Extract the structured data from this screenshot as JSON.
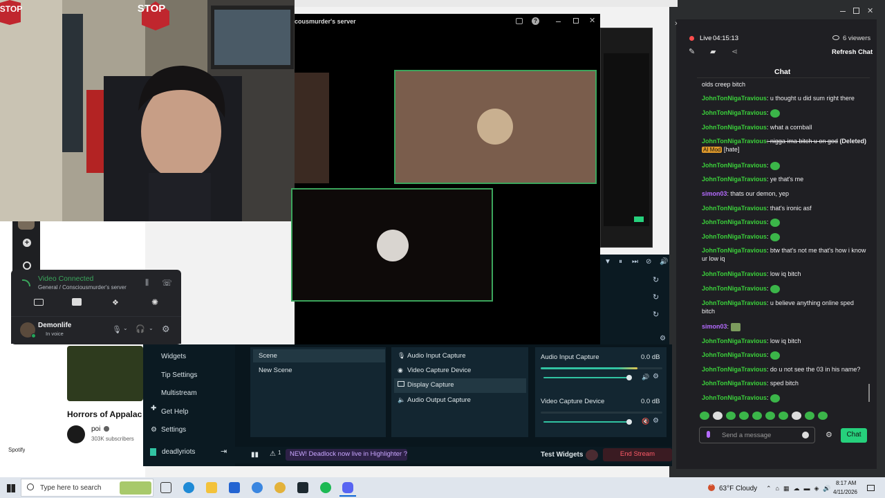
{
  "webcam": {
    "sign": "STOP",
    "sign_left": "STOP"
  },
  "discord": {
    "window_title": "cousmurder's server",
    "voice_status": "Video Connected",
    "voice_channel": "General / Consciousmurder's server",
    "user_name": "Demonlife",
    "user_status": "In voice"
  },
  "youtube": {
    "video_title": "Horrors of Appalac",
    "channel_name": "poi",
    "subscribers": "303K subscribers"
  },
  "spotify_label": "Spotify",
  "streamlabs": {
    "nav": [
      "Widgets",
      "Tip Settings",
      "Multistream",
      "Get Help",
      "Settings"
    ],
    "account": "deadlyriots",
    "scenes": [
      "Scene",
      "New Scene"
    ],
    "sources": [
      "Audio Input Capture",
      "Video Capture Device",
      "Display Capture",
      "Audio Output Capture"
    ],
    "mixer": [
      {
        "name": "Audio Input Capture",
        "db": "0.0 dB",
        "level": 0.9
      },
      {
        "name": "Video Capture Device",
        "db": "0.0 dB",
        "level": 0.0
      }
    ],
    "alert_count": "1",
    "highlighter_msg": "NEW! Deadlock now live in Highlighter ?",
    "test_widgets": "Test Widgets",
    "end_stream": "End Stream"
  },
  "chat": {
    "live_label": "Live",
    "live_time": "04:15:13",
    "viewers": "6 viewers",
    "refresh": "Refresh Chat",
    "title": "Chat",
    "messages": [
      {
        "user": "",
        "text": "olds creep bitch"
      },
      {
        "user": "JohnTonNigaTravious",
        "text": ": u thought u did sum right there"
      },
      {
        "user": "JohnTonNigaTravious",
        "text": ":"
      },
      {
        "user": "JohnTonNigaTravious",
        "text": ": what a cornball"
      },
      {
        "user": "JohnTonNigaTravious",
        "text": ": nigga ima bitch u on god",
        "note": "(Deleted)",
        "mod": "AI Mod",
        "tag": "[hate]"
      },
      {
        "user": "JohnTonNigaTravious",
        "text": ":"
      },
      {
        "user": "JohnTonNigaTravious",
        "text": ": ye that's me"
      },
      {
        "user": "simon03",
        "text": ": thats our demon, yep"
      },
      {
        "user": "JohnTonNigaTravious",
        "text": ": that's ironic asf"
      },
      {
        "user": "JohnTonNigaTravious",
        "text": ":"
      },
      {
        "user": "JohnTonNigaTravious",
        "text": ":"
      },
      {
        "user": "JohnTonNigaTravious",
        "text": ": btw that's not me that's how i know ur low iq"
      },
      {
        "user": "JohnTonNigaTravious",
        "text": ": low iq bitch"
      },
      {
        "user": "JohnTonNigaTravious",
        "text": ":"
      },
      {
        "user": "JohnTonNigaTravious",
        "text": ": u believe anything online sped bitch"
      },
      {
        "user": "simon03",
        "text": ":"
      },
      {
        "user": "JohnTonNigaTravious",
        "text": ": low iq bitch"
      },
      {
        "user": "JohnTonNigaTravious",
        "text": ":"
      },
      {
        "user": "JohnTonNigaTravious",
        "text": ": do u not see the 03 in his name?"
      },
      {
        "user": "JohnTonNigaTravious",
        "text": ": sped bitch"
      },
      {
        "user": "JohnTonNigaTravious",
        "text": ":"
      }
    ],
    "placeholder": "Send a message",
    "send_label": "Chat"
  },
  "taskbar": {
    "search_placeholder": "Type here to search",
    "weather": "63°F  Cloudy",
    "weather_badge": "2",
    "time": "8:17 AM",
    "date": "4/11/2026"
  },
  "colors": {
    "accent": "#31c3a2",
    "live": "#ff4d4d",
    "chat_user": "#3bd13b",
    "mod_user": "#b56bff",
    "discord_green": "#3ba55c"
  }
}
